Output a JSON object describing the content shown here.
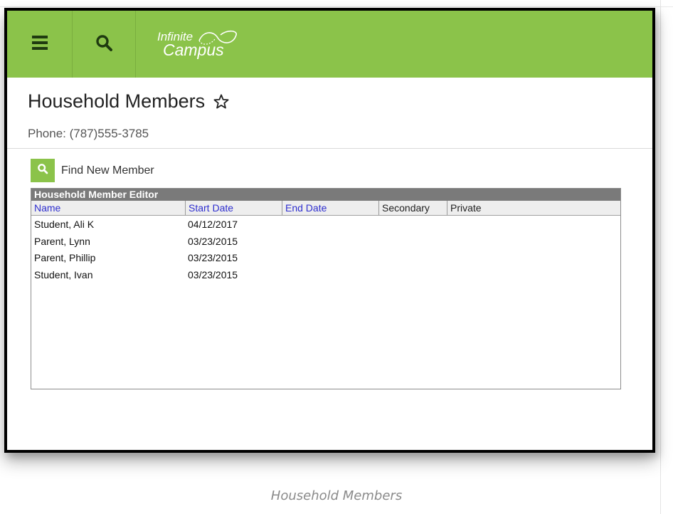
{
  "app": {
    "logo_text_line1": "Infinite",
    "logo_text_line2": "Campus",
    "brand_color": "#8bc34a"
  },
  "icons": {
    "menu": "hamburger-menu-icon",
    "search": "search-icon",
    "favorite": "star-outline-icon",
    "find": "search-icon"
  },
  "page": {
    "title": "Household Members",
    "phone": "Phone: (787)555-3785"
  },
  "toolbar": {
    "find_label": "Find New Member"
  },
  "editor": {
    "title": "Household Member Editor",
    "columns": [
      {
        "label": "Name",
        "sortable": true
      },
      {
        "label": "Start Date",
        "sortable": true
      },
      {
        "label": "End Date",
        "sortable": true
      },
      {
        "label": "Secondary",
        "sortable": false
      },
      {
        "label": "Private",
        "sortable": false
      }
    ],
    "rows": [
      {
        "name": "Student, Ali K",
        "start_date": "04/12/2017",
        "end_date": "",
        "secondary": "",
        "private": ""
      },
      {
        "name": "Parent, Lynn",
        "start_date": "03/23/2015",
        "end_date": "",
        "secondary": "",
        "private": ""
      },
      {
        "name": "Parent, Phillip",
        "start_date": "03/23/2015",
        "end_date": "",
        "secondary": "",
        "private": ""
      },
      {
        "name": "Student, Ivan",
        "start_date": "03/23/2015",
        "end_date": "",
        "secondary": "",
        "private": ""
      }
    ]
  },
  "caption": "Household Members"
}
